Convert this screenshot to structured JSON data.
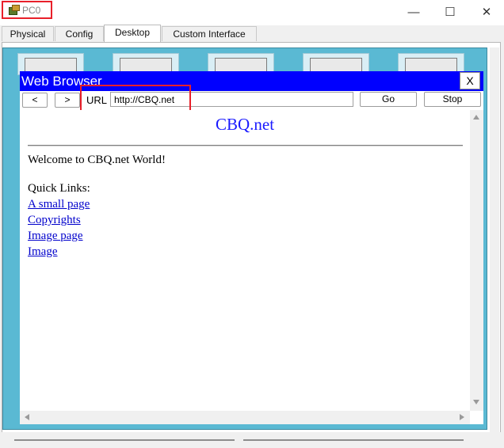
{
  "window": {
    "title": "PC0",
    "minimize_glyph": "—",
    "maximize_glyph": "☐",
    "close_glyph": "✕"
  },
  "tabs": [
    {
      "label": "Physical"
    },
    {
      "label": "Config"
    },
    {
      "label": "Desktop",
      "active": true
    },
    {
      "label": "Custom Interface"
    }
  ],
  "browser": {
    "title": "Web Browser",
    "close_label": "X",
    "back_label": "<",
    "forward_label": ">",
    "url_label": "URL",
    "url_value": "http://CBQ.net",
    "go_label": "Go",
    "stop_label": "Stop"
  },
  "page": {
    "heading": "CBQ.net",
    "welcome": "Welcome to CBQ.net World!",
    "quick_links_label": "Quick Links:",
    "links": [
      {
        "label": "A small page"
      },
      {
        "label": "Copyrights"
      },
      {
        "label": "Image page"
      },
      {
        "label": "Image"
      }
    ]
  },
  "colors": {
    "browser_title_bar": "#0000ff",
    "page_heading": "#1a1aff",
    "link": "#0000cc",
    "highlight_box": "#e8202a",
    "desktop_background": "#5ab9d3"
  }
}
